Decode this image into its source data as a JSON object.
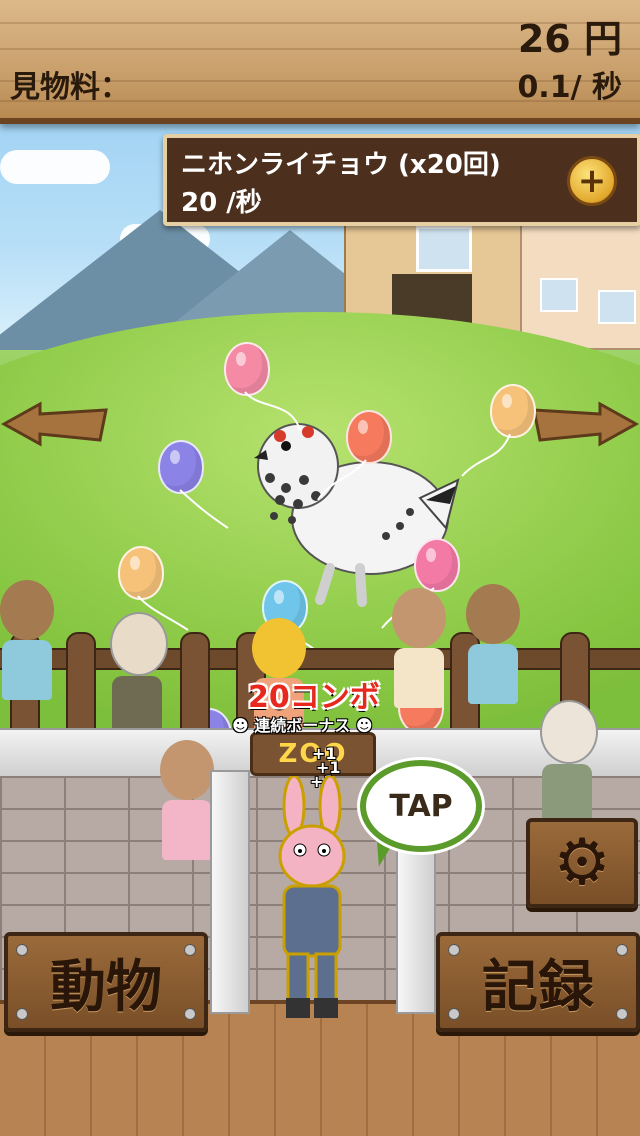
{
  "header": {
    "currency_amount": "26",
    "currency_unit": "円",
    "admission_label": "見物料：",
    "rate_value": "0.1/",
    "rate_unit": "秒"
  },
  "animal_panel": {
    "name": "ニホンライチョウ (x20回)",
    "rate": "20 /秒",
    "upgrade_icon": "plus-icon"
  },
  "combo": {
    "count": "20",
    "label": "コンボ",
    "bonus_text": "連続ボーナス",
    "plus_one": "+1"
  },
  "gate_sign": "ZOO",
  "tap_bubble": "TAP",
  "buttons": {
    "animals": "動物",
    "records": "記録",
    "settings_icon": "gear-icon"
  },
  "colors": {
    "board": "#4c2f1d",
    "accent_gold": "#e3a82c",
    "combo_red": "#e7281f",
    "tap_green": "#5b9b2b"
  }
}
